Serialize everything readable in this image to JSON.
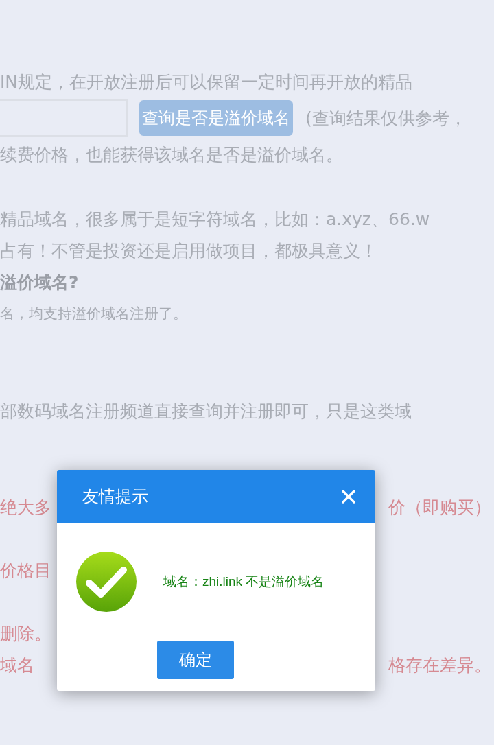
{
  "page": {
    "line_1": "IN规定，在开放注册后可以保留一定时间再开放的精品",
    "search": {
      "button": "查询是否是溢价域名",
      "note": "(查询结果仅供参考，"
    },
    "line_3": "续费价格，也能获得该域名是否是溢价域名。",
    "line_4": "精品域名，很多属于是短字符域名，比如：a.xyz、66.w",
    "line_5": "占有！不管是投资还是启用做项目，都极具意义！",
    "heading": "溢价域名?",
    "line_6": "名，均支持溢价域名注册了。",
    "line_7": "部数码域名注册频道直接查询并注册即可，只是这类域",
    "notes": [
      {
        "left": "绝大多",
        "right": "价（即购买）"
      },
      {
        "left": "价格目"
      },
      {
        "left": "删除。"
      },
      {
        "left": "域名",
        "right": "格存在差异。"
      }
    ]
  },
  "dialog": {
    "title": "友情提示",
    "message": "域名：zhi.link 不是溢价域名",
    "ok": "确定"
  }
}
